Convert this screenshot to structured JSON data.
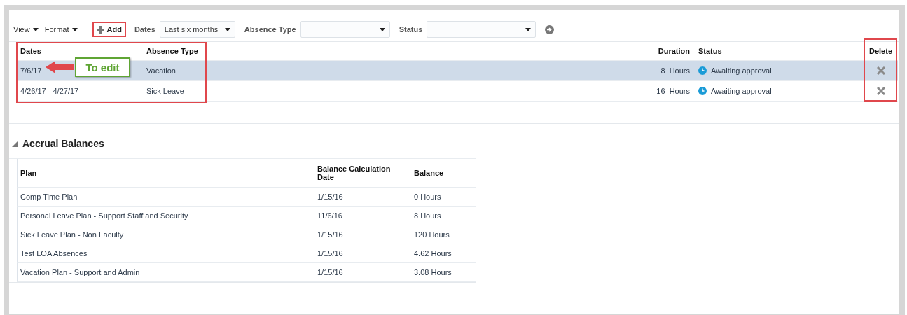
{
  "toolbar": {
    "menus": [
      {
        "label": "View"
      },
      {
        "label": "Format"
      }
    ],
    "add_button": "Add",
    "filters": [
      {
        "label": "Dates",
        "value": "Last six months"
      },
      {
        "label": "Absence Type"
      },
      {
        "label": "Status"
      }
    ]
  },
  "absences": {
    "columns": [
      "Dates",
      "Absence Type",
      "Duration",
      "Status",
      "Delete"
    ],
    "rows": [
      {
        "dates": "7/6/17",
        "absence_type": "Vacation",
        "duration": "8",
        "unit": "Hours",
        "status": "Awaiting approval",
        "selected": true
      },
      {
        "dates": "4/26/17 - 4/27/17",
        "absence_type": "Sick Leave",
        "duration": "16",
        "unit": "Hours",
        "status": "Awaiting approval",
        "selected": false
      }
    ]
  },
  "annotation": {
    "callout": "To edit"
  },
  "accrual_balances": {
    "title": "Accrual Balances",
    "expanded": true,
    "columns": [
      "Plan",
      "Balance Calculation Date",
      "Balance"
    ],
    "rows": [
      {
        "plan": "Comp Time Plan",
        "date": "1/15/16",
        "balance": "0 Hours"
      },
      {
        "plan": "Personal Leave Plan - Support Staff and Security",
        "date": "11/6/16",
        "balance": "8 Hours"
      },
      {
        "plan": "Sick Leave Plan - Non Faculty",
        "date": "1/15/16",
        "balance": "120 Hours"
      },
      {
        "plan": "Test LOA Absences",
        "date": "1/15/16",
        "balance": "4.62 Hours"
      },
      {
        "plan": "Vacation Plan - Support and Admin",
        "date": "1/15/16",
        "balance": "3.08 Hours"
      }
    ]
  }
}
